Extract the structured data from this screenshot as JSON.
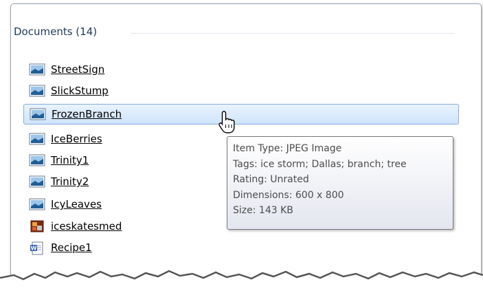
{
  "group": {
    "title": "Documents (14)"
  },
  "items": [
    {
      "label": "StreetSign",
      "icon": "image-file-icon"
    },
    {
      "label": "SlickStump",
      "icon": "image-file-icon"
    },
    {
      "label": "FrozenBranch",
      "icon": "image-file-icon",
      "selected": true
    },
    {
      "label": "IceBerries",
      "icon": "image-file-icon"
    },
    {
      "label": "Trinity1",
      "icon": "image-file-icon"
    },
    {
      "label": "Trinity2",
      "icon": "image-file-icon"
    },
    {
      "label": "IcyLeaves",
      "icon": "image-file-icon"
    },
    {
      "label": "iceskatesmed",
      "icon": "photo-file-icon"
    },
    {
      "label": "Recipe1",
      "icon": "word-document-icon"
    }
  ],
  "tooltip": {
    "item_type": "Item Type: JPEG Image",
    "tags": "Tags: ice storm; Dallas; branch; tree",
    "rating": "Rating: Unrated",
    "dimensions": "Dimensions: 600 x 800",
    "size": "Size: 143 KB"
  },
  "colors": {
    "header_text": "#1e395b",
    "selection_border": "#84acdd",
    "selection_fill": "#cfe4fb"
  }
}
